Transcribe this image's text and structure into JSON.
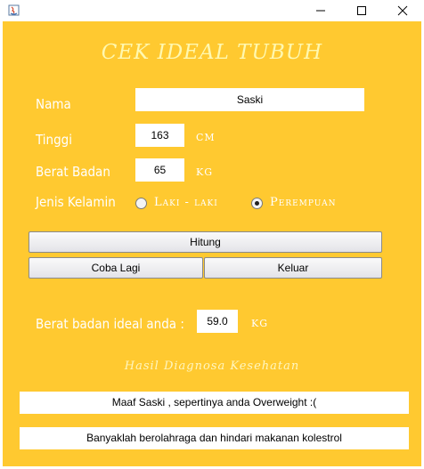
{
  "window": {
    "controls": {
      "minimize": "—",
      "maximize": "☐",
      "close": "✕"
    }
  },
  "form": {
    "title": "CEK IDEAL TUBUH",
    "name_label": "Nama",
    "name_value": "Saski",
    "height_label": "Tinggi",
    "height_value": "163",
    "height_unit": "CM",
    "weight_label": "Berat Badan",
    "weight_value": "65",
    "weight_unit": "KG",
    "gender_label": "Jenis Kelamin",
    "gender_options": [
      {
        "label": "Laki - laki",
        "selected": false
      },
      {
        "label": "Perempuan",
        "selected": true
      }
    ]
  },
  "buttons": {
    "calculate": "Hitung",
    "retry": "Coba Lagi",
    "exit": "Keluar"
  },
  "result": {
    "ideal_label": "Berat badan ideal anda :",
    "ideal_value": "59.0",
    "ideal_unit": "KG",
    "diagnosis_title": "Hasil Diagnosa Kesehatan",
    "diagnosis_message": "Maaf Saski , sepertinya anda Overweight :(",
    "advice": "Banyaklah berolahraga dan hindari makanan kolestrol"
  },
  "colors": {
    "background": "#ffc930",
    "label": "#ffffff"
  }
}
